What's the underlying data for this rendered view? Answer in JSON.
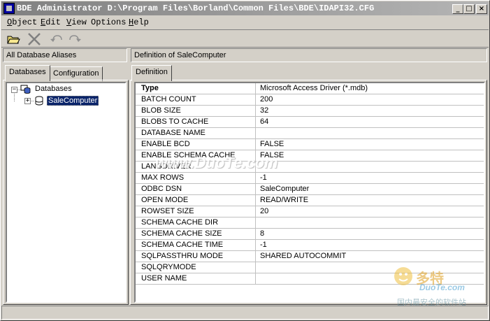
{
  "window": {
    "title": "BDE Administrator  D:\\Program Files\\Borland\\Common Files\\BDE\\IDAPI32.CFG",
    "buttons": {
      "minimize": "_",
      "maximize": "□",
      "close": "×"
    }
  },
  "menu": [
    {
      "acc": "O",
      "rest": "bject"
    },
    {
      "acc": "E",
      "rest": "dit"
    },
    {
      "acc": "V",
      "rest": "iew"
    },
    {
      "acc": "",
      "rest": "Options"
    },
    {
      "acc": "H",
      "rest": "elp"
    }
  ],
  "toolbar": {
    "icons": [
      "open-folder-icon",
      "delete-x-icon",
      "undo-icon",
      "redo-icon"
    ]
  },
  "left": {
    "header": "All Database Aliases",
    "tabs": [
      "Databases",
      "Configuration"
    ],
    "tree": {
      "root": "Databases",
      "child": "SaleComputer"
    }
  },
  "right": {
    "header": "Definition of SaleComputer",
    "tab": "Definition",
    "rows": [
      {
        "key": "Type",
        "value": "Microsoft Access Driver (*.mdb)"
      },
      {
        "key": "BATCH COUNT",
        "value": "200"
      },
      {
        "key": "BLOB SIZE",
        "value": "32"
      },
      {
        "key": "BLOBS TO CACHE",
        "value": "64"
      },
      {
        "key": "DATABASE NAME",
        "value": ""
      },
      {
        "key": "ENABLE BCD",
        "value": "FALSE"
      },
      {
        "key": "ENABLE SCHEMA CACHE",
        "value": "FALSE"
      },
      {
        "key": "LANGDRIVER",
        "value": ""
      },
      {
        "key": "MAX ROWS",
        "value": "-1"
      },
      {
        "key": "ODBC DSN",
        "value": "SaleComputer"
      },
      {
        "key": "OPEN MODE",
        "value": "READ/WRITE"
      },
      {
        "key": "ROWSET SIZE",
        "value": "20"
      },
      {
        "key": "SCHEMA CACHE DIR",
        "value": ""
      },
      {
        "key": "SCHEMA CACHE SIZE",
        "value": "8"
      },
      {
        "key": "SCHEMA CACHE TIME",
        "value": "-1"
      },
      {
        "key": "SQLPASSTHRU MODE",
        "value": "SHARED AUTOCOMMIT"
      },
      {
        "key": "SQLQRYMODE",
        "value": ""
      },
      {
        "key": "USER NAME",
        "value": ""
      }
    ]
  },
  "watermark": {
    "middle": "www.DuoTe.com",
    "brand_cn": "多特",
    "brand_en": "DuoTe.com",
    "slogan": "国内最安全的软件站"
  }
}
